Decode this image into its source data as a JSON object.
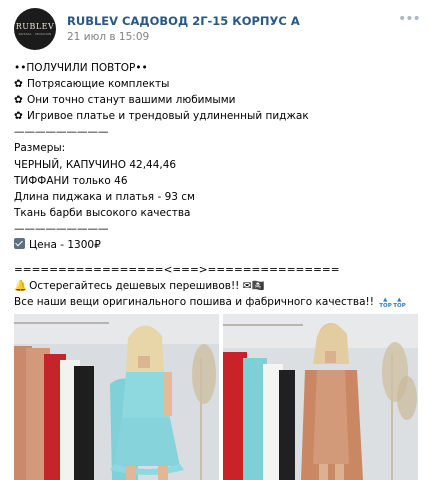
{
  "post": {
    "author": "RUBLEV САДОВОД 2Г-15 КОРПУС А",
    "date": "21 июл в 15:09",
    "avatar": {
      "logo_word": "RUBLEV",
      "logo_sub": "ROSSIA · MOSCOW"
    },
    "more_icon": "more-dots-icon",
    "lines": {
      "l1": "••ПОЛУЧИЛИ ПОВТОР••",
      "l2": "Потрясающие комплекты",
      "l3": "Они точно станут вашими любимыми",
      "l4": "Игривое платье и трендовый удлиненный пиджак",
      "l5": "—————————",
      "l6": "Размеры:",
      "l7": "ЧЕРНЫЙ, КАПУЧИНО 42,44,46",
      "l8": "ТИФФАНИ только 46",
      "l9": "Длина пиджака и платья - 93 см",
      "l10": "Ткань барби высокого качества",
      "l11": "—————————",
      "l12": "Цена - 1300₽",
      "l13": "=================<===>===============",
      "l14": "Остерегайтесь дешевых перешивов!!",
      "l14_emoji": "✉🏴‍☠️",
      "l15": "Все наши вещи оригинального пошива и фабричного качества!!"
    },
    "flower": "✿",
    "top_badge": "TOP",
    "colors": {
      "link": "#2a5885",
      "meta": "#828282"
    }
  }
}
